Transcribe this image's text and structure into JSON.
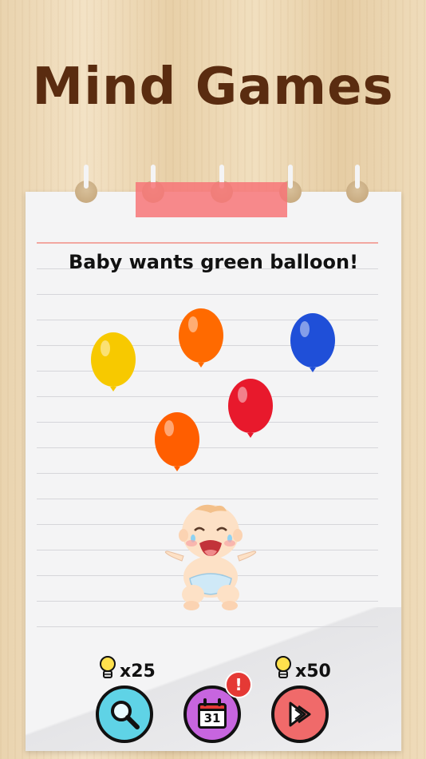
{
  "header": {
    "title": "Mind Games"
  },
  "level": {
    "prompt": "Baby wants green balloon!"
  },
  "balloons": [
    {
      "color_name": "yellow",
      "color": "#f7c900"
    },
    {
      "color_name": "orange",
      "color": "#ff6a00"
    },
    {
      "color_name": "blue",
      "color": "#1f4fd8"
    },
    {
      "color_name": "red",
      "color": "#e8192c"
    },
    {
      "color_name": "orange",
      "color": "#ff5e00"
    }
  ],
  "toolbar": {
    "search_hint_count": "x25",
    "skip_hint_count": "x50",
    "calendar_day": "31",
    "calendar_badge": "!"
  },
  "colors": {
    "title": "#5a2c10",
    "search_button": "#5fd3e6",
    "calendar_button": "#c765df",
    "skip_button": "#f06a6a",
    "tape": "#f77678"
  }
}
